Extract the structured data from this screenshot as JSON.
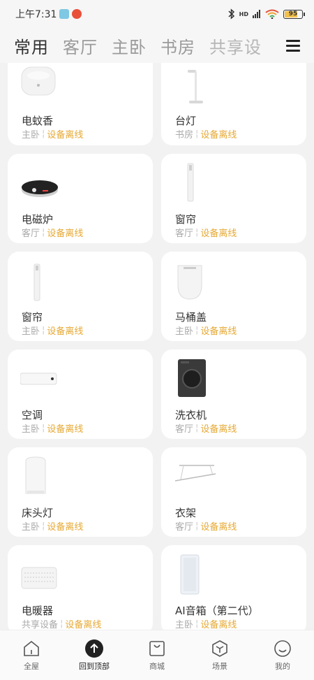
{
  "status_bar": {
    "time": "上午7:31",
    "hd_label": "HD",
    "battery": "95"
  },
  "tabs": [
    {
      "label": "常用",
      "active": true
    },
    {
      "label": "客厅",
      "active": false
    },
    {
      "label": "主卧",
      "active": false
    },
    {
      "label": "书房",
      "active": false
    },
    {
      "label": "共享设",
      "active": false
    }
  ],
  "status_text": "设备离线",
  "devices": [
    {
      "name": "电蚊香",
      "room": "主卧",
      "icon": "mosquito-repellent-icon"
    },
    {
      "name": "台灯",
      "room": "书房",
      "icon": "desk-lamp-icon"
    },
    {
      "name": "电磁炉",
      "room": "客厅",
      "icon": "induction-cooker-icon"
    },
    {
      "name": "窗帘",
      "room": "客厅",
      "icon": "curtain-icon"
    },
    {
      "name": "窗帘",
      "room": "主卧",
      "icon": "curtain-icon"
    },
    {
      "name": "马桶盖",
      "room": "主卧",
      "icon": "toilet-seat-icon"
    },
    {
      "name": "空调",
      "room": "主卧",
      "icon": "air-conditioner-icon"
    },
    {
      "name": "洗衣机",
      "room": "客厅",
      "icon": "washing-machine-icon"
    },
    {
      "name": "床头灯",
      "room": "主卧",
      "icon": "bedside-lamp-icon"
    },
    {
      "name": "衣架",
      "room": "客厅",
      "icon": "clothes-rack-icon"
    },
    {
      "name": "电暖器",
      "room": "共享设备",
      "icon": "heater-icon"
    },
    {
      "name": "AI音箱（第二代）",
      "room": "主卧",
      "icon": "smart-speaker-icon"
    }
  ],
  "bottom_nav": [
    {
      "label": "全屋",
      "icon": "home-icon"
    },
    {
      "label": "回到顶部",
      "icon": "back-to-top-icon"
    },
    {
      "label": "商城",
      "icon": "shop-icon"
    },
    {
      "label": "场景",
      "icon": "scene-icon"
    },
    {
      "label": "我的",
      "icon": "profile-icon"
    }
  ],
  "colors": {
    "offline": "#e6a935",
    "background": "#f2f2f2",
    "card": "#ffffff"
  }
}
